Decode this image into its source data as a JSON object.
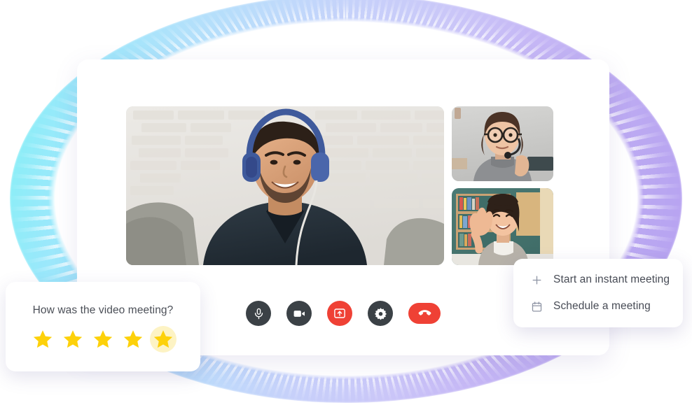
{
  "window": {
    "name": "video-meeting-window"
  },
  "videos": {
    "main": {
      "name": "main-speaker-video",
      "description": "Smiling man wearing blue over-ear headphones in front of a white brick wall"
    },
    "thumbnails": [
      {
        "name": "participant-video-1",
        "description": "Woman with glasses and headset in a grey turtleneck"
      },
      {
        "name": "participant-video-2",
        "description": "Smiling woman with dark bob hair raising her hand in front of a bookshelf"
      }
    ]
  },
  "controls": {
    "buttons": [
      {
        "name": "microphone-button",
        "icon": "microphone-icon",
        "style": "dark"
      },
      {
        "name": "camera-button",
        "icon": "video-camera-icon",
        "style": "dark"
      },
      {
        "name": "share-screen-button",
        "icon": "screen-share-icon",
        "style": "danger"
      },
      {
        "name": "settings-button",
        "icon": "gear-icon",
        "style": "dark"
      },
      {
        "name": "end-call-button",
        "icon": "phone-hangup-icon",
        "style": "hangup"
      }
    ]
  },
  "rating": {
    "title": "How was the video meeting?",
    "stars": [
      {
        "label": "1 star",
        "selected": false
      },
      {
        "label": "2 stars",
        "selected": false
      },
      {
        "label": "3 stars",
        "selected": false
      },
      {
        "label": "4 stars",
        "selected": false
      },
      {
        "label": "5 stars",
        "selected": true
      }
    ],
    "star_color": "#FDD10A",
    "highlight_color": "#FDF3C4"
  },
  "menu": {
    "items": [
      {
        "label": "Start an instant meeting",
        "icon": "plus-icon"
      },
      {
        "label": "Schedule a meeting",
        "icon": "calendar-icon"
      }
    ]
  },
  "theme": {
    "ring_gradient_start": "#7FF1F5",
    "ring_gradient_mid": "#C5CFFA",
    "ring_gradient_end": "#B39EF0",
    "control_dark": "#3B4146",
    "control_danger": "#EF4135",
    "text_primary": "#474B55"
  }
}
